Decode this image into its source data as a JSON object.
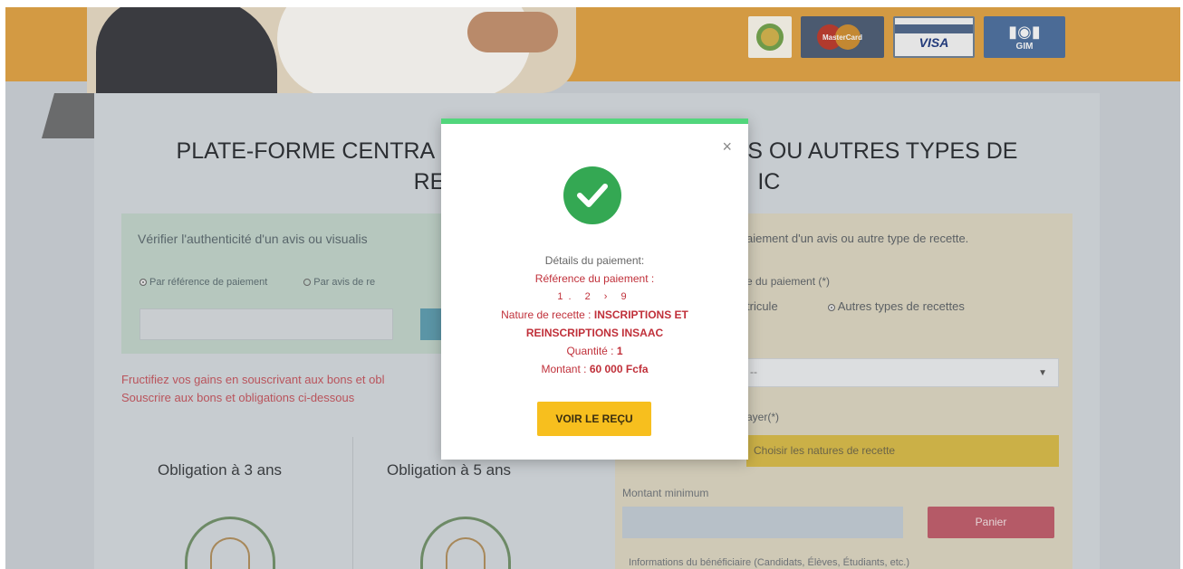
{
  "header": {
    "logos": [
      "round-seal-logo",
      "mastercard-logo",
      "visa-logo",
      "gim-logo"
    ],
    "mastercard_text": "MasterCard",
    "visa_text": "VISA",
    "gim_text": "GIM"
  },
  "main": {
    "title_line1": "PLATE-FORME CENTRA",
    "title_line1_right": "S OU AUTRES TYPES DE",
    "title_line2_left": "RE",
    "title_line2_right": "IC"
  },
  "verify": {
    "title": "Vérifier l'authenticité d'un avis ou visualis",
    "radio_ref": "Par référence de paiement",
    "radio_avis": "Par avis de re"
  },
  "promo": {
    "line1": "Fructifiez vos gains en souscrivant aux bons et obl",
    "line2": "Souscrire aux bons et obligations ci-dessous"
  },
  "bonds": {
    "bond1": "Obligation à 3 ans",
    "bond2": "Obligation à 5 ans"
  },
  "payment": {
    "title": "aiement d'un avis ou autre type de recette.",
    "type_label": "e du paiement (*)",
    "radio_matricule": "tricule",
    "radio_autres": "Autres types de recettes",
    "select_value": "--",
    "payer_label": "ayer(*)",
    "choose_button": "Choisir les natures de recette",
    "min_label": "Montant minimum",
    "cart_button": "Panier",
    "benef_label": "Informations du bénéficiaire (Candidats, Élèves, Étudiants, etc.)"
  },
  "modal": {
    "close": "×",
    "details_label": "Détails du paiement:",
    "ref_label": "Référence du paiement :",
    "ref_value": "1.    2 › 9",
    "nature_label": "Nature de recette : ",
    "nature_value_1": "INSCRIPTIONS ET",
    "nature_value_2": "REINSCRIPTIONS INSAAC",
    "qty_label": "Quantité : ",
    "qty_value": "1",
    "amount_label": "Montant : ",
    "amount_value": "60 000 Fcfa",
    "receipt_button": "VOIR LE REÇU"
  },
  "colors": {
    "header": "#d39a43",
    "success": "#34a853",
    "modal_top": "#52d67c",
    "receipt_button": "#f7bf1e",
    "error_red": "#c0303a"
  }
}
